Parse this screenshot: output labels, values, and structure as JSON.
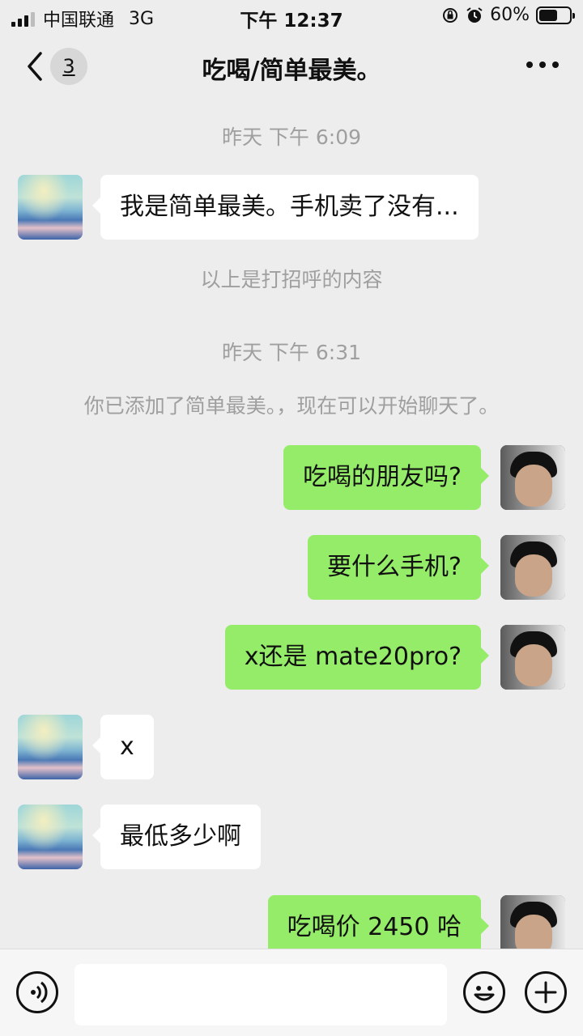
{
  "status_bar": {
    "carrier": "中国联通",
    "network": "3G",
    "time": "下午 12:37",
    "battery": "60%",
    "battery_level": 0.6
  },
  "nav": {
    "unread_count": "3",
    "title": "吃喝/简单最美。"
  },
  "chat": {
    "timestamp_1": "昨天 下午 6:09",
    "greeting_note": "以上是打招呼的内容",
    "timestamp_2": "昨天 下午 6:31",
    "added_notice": "你已添加了简单最美。，现在可以开始聊天了。",
    "messages": [
      {
        "from": "them",
        "text": "我是简单最美。手机卖了没有..."
      },
      {
        "from": "me",
        "text": "吃喝的朋友吗?"
      },
      {
        "from": "me",
        "text": "要什么手机?"
      },
      {
        "from": "me",
        "text": "x还是 mate20pro?"
      },
      {
        "from": "them",
        "text": "x"
      },
      {
        "from": "them",
        "text": "最低多少啊"
      },
      {
        "from": "me",
        "text": "吃喝价 2450 哈"
      }
    ]
  },
  "input_bar": {
    "voice_icon": "voice-icon",
    "emoji_icon": "emoji-icon",
    "plus_icon": "plus-icon"
  },
  "colors": {
    "background": "#ededed",
    "outgoing_bubble": "#95ec69",
    "incoming_bubble": "#ffffff",
    "system_text": "#9f9f9f"
  }
}
